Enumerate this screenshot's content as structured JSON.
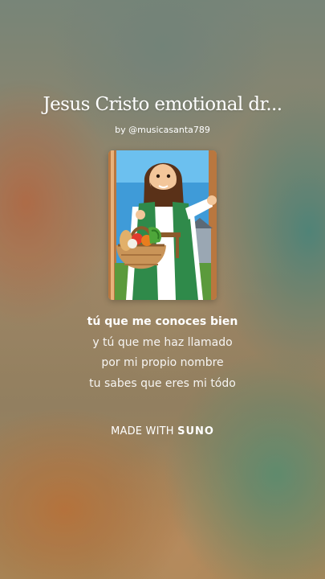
{
  "song": {
    "title": "Jesus Cristo emotional dr...",
    "byline": "by @musicasanta789"
  },
  "cover": {
    "icon": "cover-art-jesus-with-basket"
  },
  "lyrics": {
    "lines": [
      "tú que me conoces bien",
      "y tú que me haz llamado",
      "por mi propio nombre",
      "tu sabes que eres mi tódo"
    ],
    "active_index": 0
  },
  "footer": {
    "prefix": "MADE WITH",
    "brand": "SUNO"
  }
}
